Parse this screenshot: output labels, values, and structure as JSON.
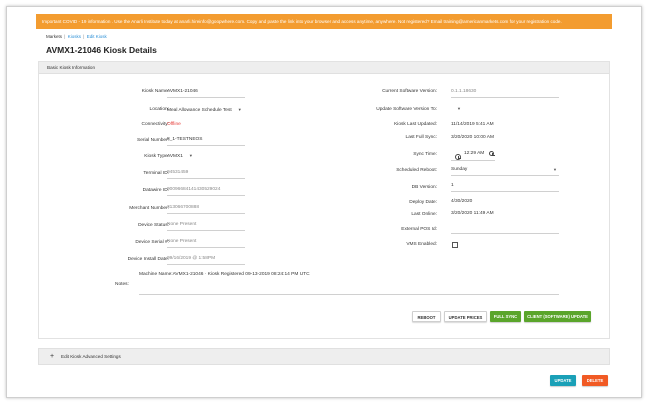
{
  "banner": {
    "text": "Important COVID - 19 information . Use the Anarli Institute today at anarli.hireinfo@goopwhere.com. Copy and paste the link into your browser and access anytime, anywhere. Not registered? Email training@americanmarkets.com for your registration code."
  },
  "breadcrumb": {
    "markets": "Markets",
    "kiosks": "Kiosks",
    "current": "Edit Kiosk",
    "separator": "|"
  },
  "page": {
    "title": "AVMX1-21046 Kiosk Details"
  },
  "basic_info": {
    "header": "Basic Kiosk Information",
    "left_fields": [
      {
        "label": "Kiosk Name:",
        "value": "AVMX1-21046"
      },
      {
        "label": "Location:",
        "value": "Meal Allowance Schedule Test"
      },
      {
        "label": "Connectivity:",
        "value": "Offline"
      },
      {
        "label": "Serial Number:",
        "value": "8_1-TESTNEOS"
      },
      {
        "label": "Kiosk Type:",
        "value": "AVMX1"
      },
      {
        "label": "Terminal ID:",
        "value": "04531459"
      },
      {
        "label": "Datawire ID:",
        "value": "00096684141430529024"
      },
      {
        "label": "Merchant Number:",
        "value": "313066700888"
      },
      {
        "label": "Device Status:",
        "value": "None Present"
      },
      {
        "label": "Device Serial #:",
        "value": "None Present"
      },
      {
        "label": "Device Install Date:",
        "value": "09/16/2019 @ 1:58PM"
      }
    ],
    "right_fields": [
      {
        "label": "Current Software Version:",
        "value": "0.1.1.18630"
      },
      {
        "label": "Update Software Version To:",
        "value": ""
      },
      {
        "label": "Kiosk Last Updated:",
        "value": "11/14/2019 5:41 AM"
      },
      {
        "label": "Last Full Sync:",
        "value": "3/20/2020 10:00 AM"
      },
      {
        "label": "Sync Time:",
        "value": "12:29 AM"
      },
      {
        "label": "Scheduled Reboot:",
        "value": "Sunday"
      },
      {
        "label": "DB Version:",
        "value": "1"
      },
      {
        "label": "Deploy Date:",
        "value": "4/30/2020"
      },
      {
        "label": "Last Online:",
        "value": "3/20/2020 11:49 AM"
      },
      {
        "label": "External POS Id:",
        "value": ""
      },
      {
        "label": "VMS Enabled:",
        "value": ""
      }
    ],
    "notes_label": "Notes:",
    "notes_value": "Machine Name:AVMX1-21046 · Kiosk Registered 09-13-2019 08:24:14 PM UTC"
  },
  "actions": {
    "reboot": "REBOOT",
    "update_prices": "UPDATE PRICES",
    "full_sync": "FULL SYNC",
    "client_update": "CLIENT (SOFTWARE) UPDATE"
  },
  "advanced": {
    "label": "Edit Kiosk Advanced Settings",
    "expand_symbol": "+"
  },
  "footer": {
    "update": "UPDATE",
    "delete": "DELETE"
  },
  "colors": {
    "banner": "#f39c30",
    "green": "#5aa52b",
    "teal": "#1aa0b7",
    "orange": "#f15a24",
    "link": "#2a8fd6",
    "offline": "#e53935"
  },
  "icons": {
    "dropdown": "caret-down-icon",
    "clock": "clock-icon",
    "expand": "plus-icon"
  }
}
